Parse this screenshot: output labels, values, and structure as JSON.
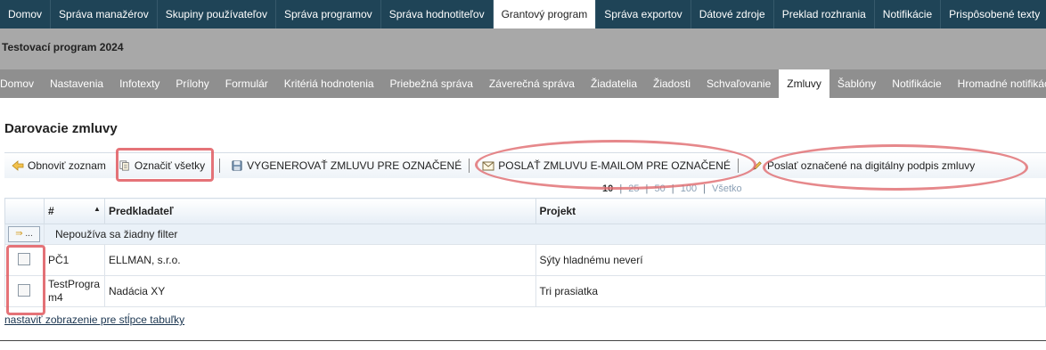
{
  "top_nav": [
    "Domov",
    "Správa manažérov",
    "Skupiny používateľov",
    "Správa programov",
    "Správa hodnotiteľov",
    "Grantový program",
    "Správa exportov",
    "Dátové zdroje",
    "Preklad rozhrania",
    "Notifikácie",
    "Prispôsobené texty"
  ],
  "program_title": "Testovací program 2024",
  "sub_nav": [
    "Domov",
    "Nastavenia",
    "Infotexty",
    "Prílohy",
    "Formulár",
    "Kritériá hodnotenia",
    "Priebežná správa",
    "Záverečná správa",
    "Žiadatelia",
    "Žiadosti",
    "Schvaľovanie",
    "Zmluvy",
    "Šablóny",
    "Notifikácie",
    "Hromadné notifikácie"
  ],
  "section_title": "Darovacie zmluvy",
  "toolbar": {
    "refresh": "Obnoviť zoznam",
    "select_all": "Označiť všetky",
    "generate": "VYGENEROVAŤ ZMLUVU PRE OZNAČENÉ",
    "email": "POSLAŤ ZMLUVU E-MAILOM PRE OZNAČENÉ",
    "sign": "Poslať označené na digitálny podpis zmluvy"
  },
  "paging": {
    "current": "10",
    "options": [
      "25",
      "50",
      "100",
      "Všetko"
    ]
  },
  "columns": {
    "num": "#",
    "submitter": "Predkladateľ",
    "project": "Projekt"
  },
  "filter": {
    "button": "...",
    "text": "Nepoužíva sa žiadny filter"
  },
  "rows": [
    {
      "num": "PČ1",
      "submitter": "ELLMAN, s.r.o.",
      "project": "Sýty hladnému neverí"
    },
    {
      "num": "TestProgram4",
      "submitter": "Nadácia XY",
      "project": "Tri prasiatka"
    }
  ],
  "columns_link": "nastaviť zobrazenie pre stĺpce tabuľky",
  "colors": {
    "topnav": "#1f4457",
    "program_bar": "#a8a8a8",
    "subnav": "#8f8f8f",
    "highlight": "#e05a60"
  }
}
